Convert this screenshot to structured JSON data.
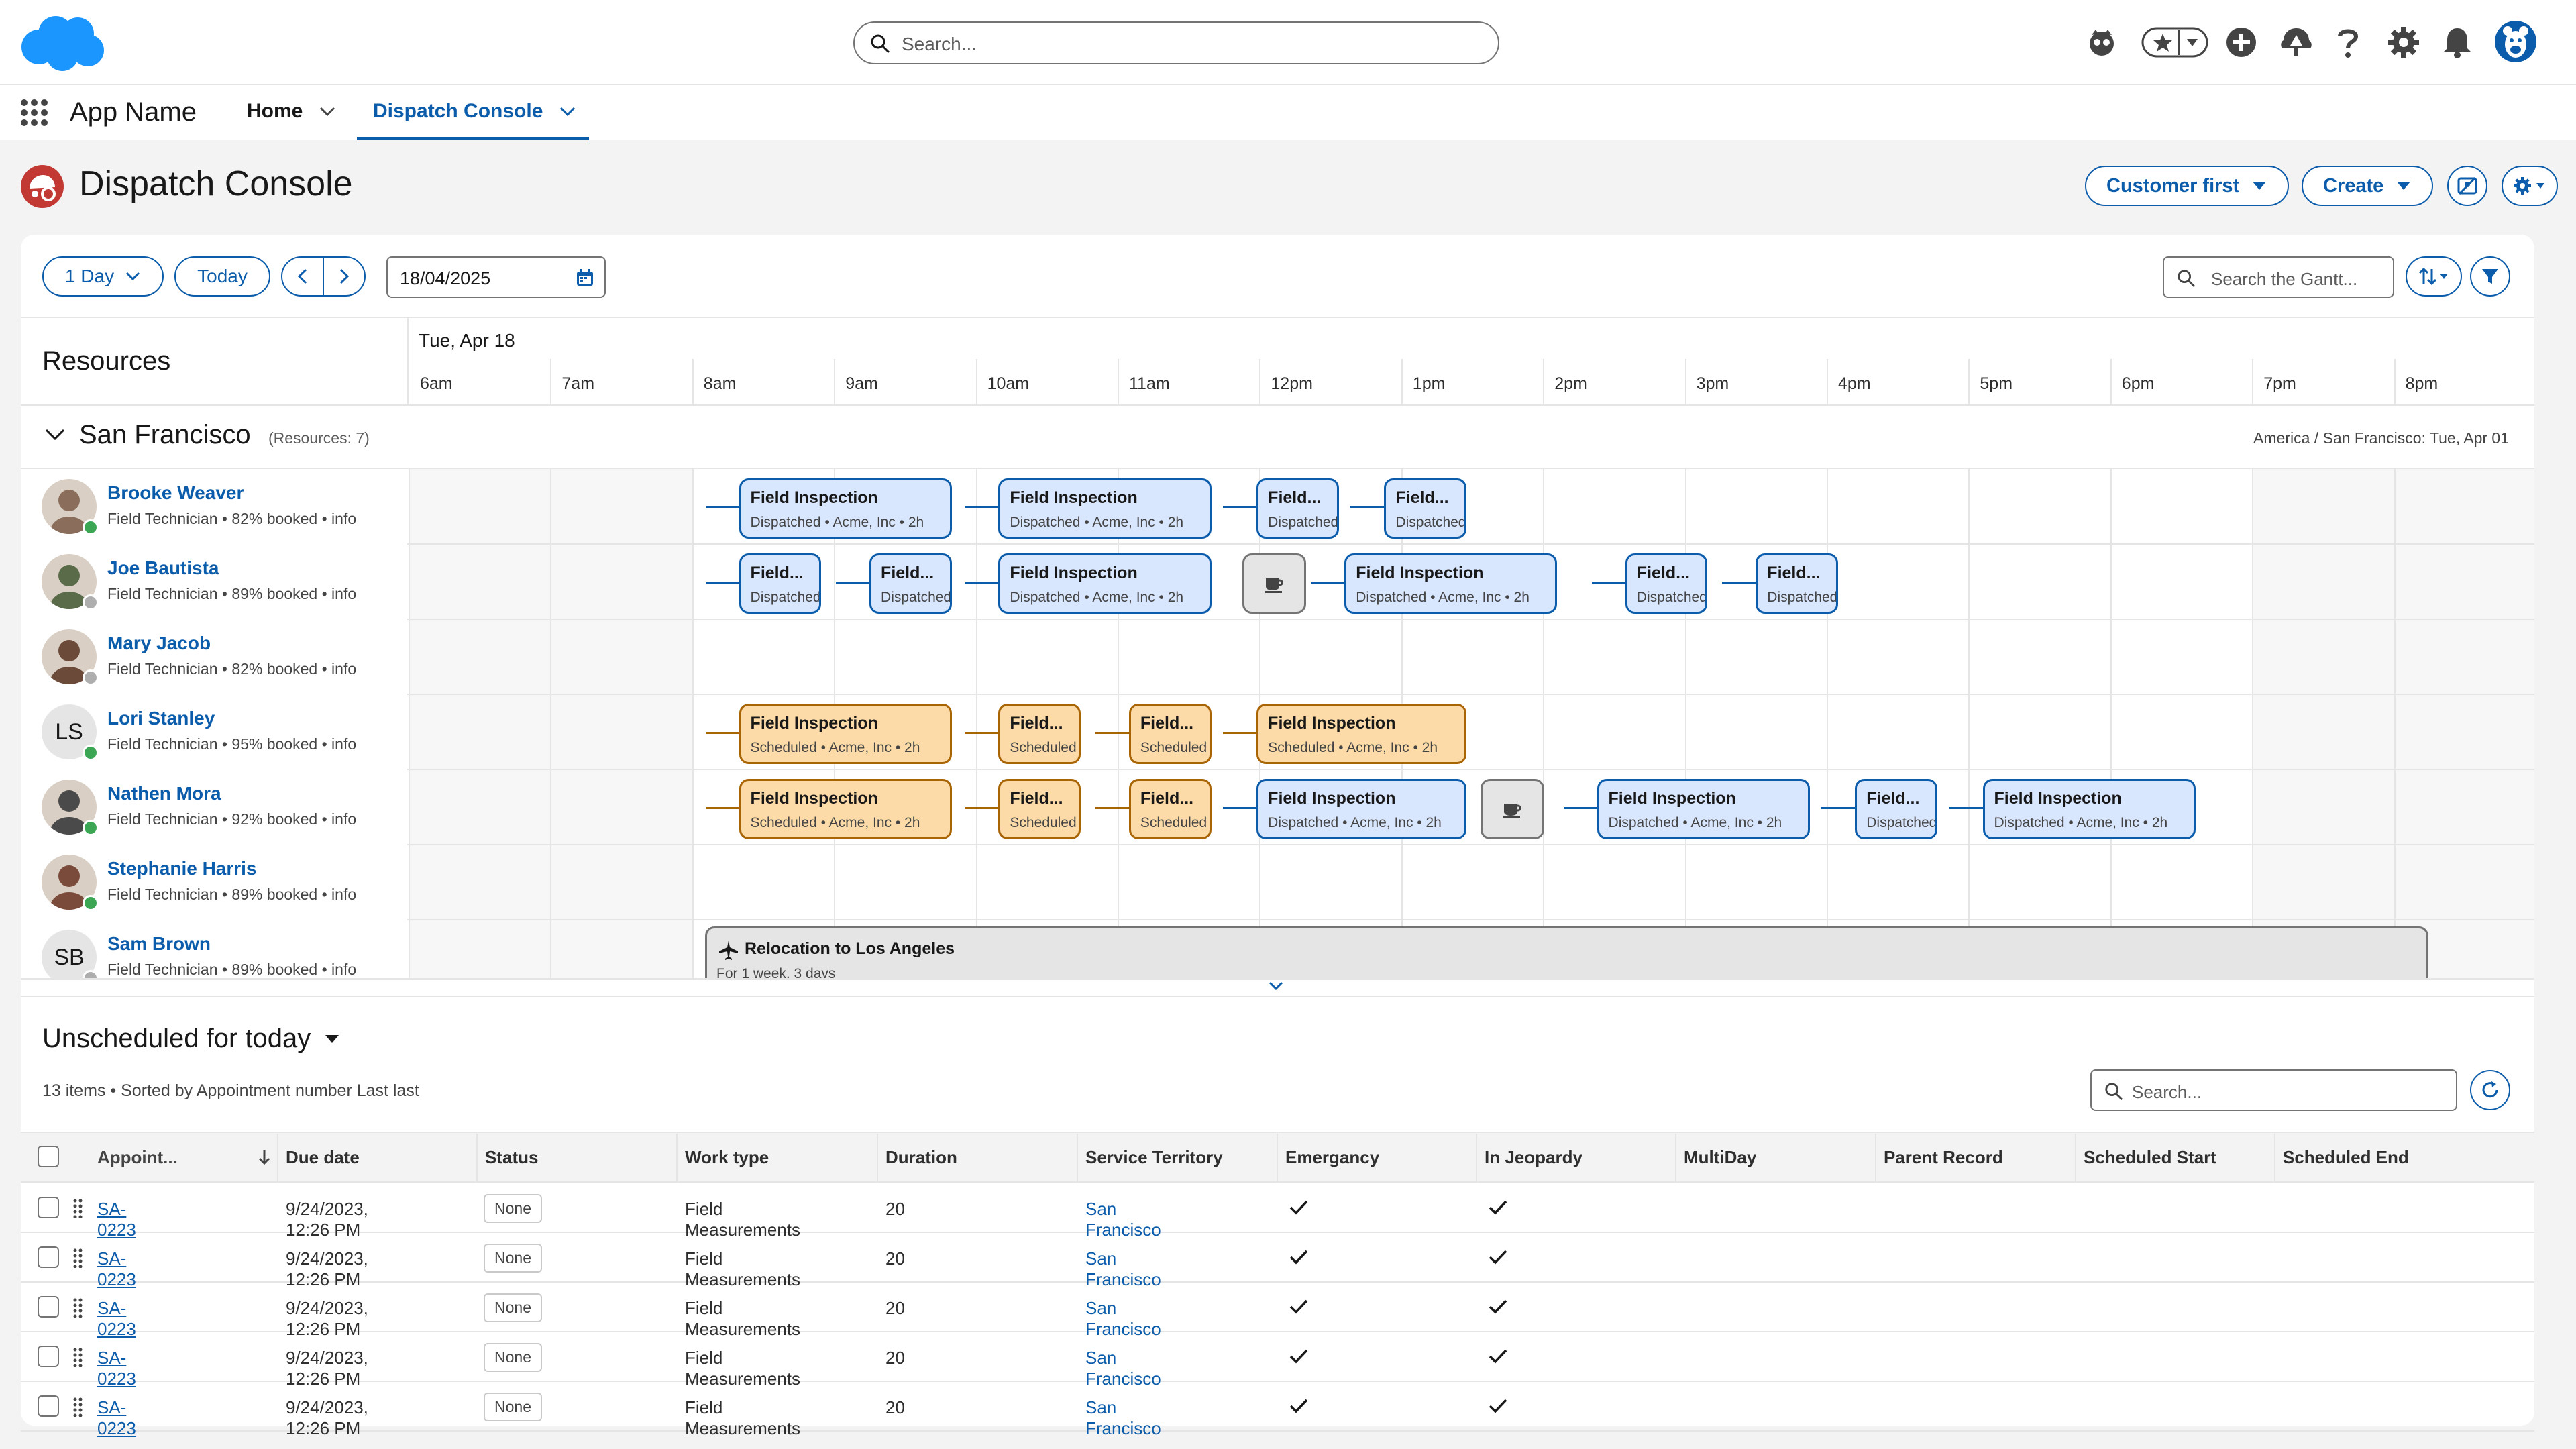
{
  "global_search": {
    "placeholder": "Search..."
  },
  "app": {
    "name": "App Name"
  },
  "nav": {
    "tabs": [
      {
        "label": "Home"
      },
      {
        "label": "Dispatch Console"
      }
    ]
  },
  "page": {
    "title": "Dispatch Console",
    "buttons": {
      "customer_first": "Customer first",
      "create": "Create"
    }
  },
  "toolbar": {
    "view": "1 Day",
    "today": "Today",
    "date": "18/04/2025",
    "gantt_search_placeholder": "Search the Gantt..."
  },
  "gantt": {
    "resources_header": "Resources",
    "date_label": "Tue, Apr 18",
    "hours": [
      "6am",
      "7am",
      "8am",
      "9am",
      "10am",
      "11am",
      "12pm",
      "1pm",
      "2pm",
      "3pm",
      "4pm",
      "5pm",
      "6pm",
      "7pm",
      "8pm"
    ],
    "group": {
      "name": "San Francisco",
      "count": "(Resources: 7)",
      "timezone": "America / San Francisco: Tue, Apr 01"
    },
    "resources": [
      {
        "name": "Brooke Weaver",
        "sub": "Field Technician • 82% booked • info",
        "status_color": "#3ba755"
      },
      {
        "name": "Joe Bautista",
        "sub": "Field Technician • 89% booked • info",
        "status_color": "#aeaeae"
      },
      {
        "name": "Mary Jacob",
        "sub": "Field Technician • 82% booked • info",
        "status_color": "#aeaeae"
      },
      {
        "name": "Lori Stanley",
        "sub": "Field Technician • 95% booked • info",
        "status_color": "#3ba755",
        "initials": "LS"
      },
      {
        "name": "Nathen Mora",
        "sub": "Field Technician • 92% booked • info",
        "status_color": "#3ba755"
      },
      {
        "name": "Stephanie Harris",
        "sub": "Field Technician • 89% booked • info",
        "status_color": "#3ba755"
      },
      {
        "name": "Sam Brown",
        "sub": "Field Technician • 89% booked • info",
        "status_color": "#aeaeae",
        "initials": "SB"
      }
    ],
    "appointments": [
      {
        "row": 0,
        "start": 8.33,
        "end": 9.83,
        "title": "Field Inspection",
        "sub": "Dispatched • Acme, Inc • 2h",
        "color": "blue"
      },
      {
        "row": 0,
        "start": 10.16,
        "end": 11.66,
        "title": "Field Inspection",
        "sub": "Dispatched • Acme, Inc • 2h",
        "color": "blue"
      },
      {
        "row": 0,
        "start": 11.98,
        "end": 12.56,
        "title": "Field...",
        "sub": "Dispatched",
        "color": "blue"
      },
      {
        "row": 0,
        "start": 12.88,
        "end": 13.46,
        "title": "Field...",
        "sub": "Dispatched",
        "color": "blue"
      },
      {
        "row": 1,
        "start": 8.33,
        "end": 8.91,
        "title": "Field...",
        "sub": "Dispatched",
        "color": "blue"
      },
      {
        "row": 1,
        "start": 9.25,
        "end": 9.83,
        "title": "Field...",
        "sub": "Dispatched",
        "color": "blue"
      },
      {
        "row": 1,
        "start": 10.16,
        "end": 11.66,
        "title": "Field Inspection",
        "sub": "Dispatched • Acme, Inc • 2h",
        "color": "blue"
      },
      {
        "row": 1,
        "start": 11.88,
        "end": 12.33,
        "title": "",
        "sub": "",
        "color": "break"
      },
      {
        "row": 1,
        "start": 12.6,
        "end": 14.1,
        "title": "Field Inspection",
        "sub": "Dispatched • Acme, Inc • 2h",
        "color": "blue"
      },
      {
        "row": 1,
        "start": 14.58,
        "end": 15.16,
        "title": "Field...",
        "sub": "Dispatched",
        "color": "blue"
      },
      {
        "row": 1,
        "start": 15.5,
        "end": 16.08,
        "title": "Field...",
        "sub": "Dispatched",
        "color": "blue"
      },
      {
        "row": 3,
        "start": 8.33,
        "end": 9.83,
        "title": "Field Inspection",
        "sub": "Scheduled • Acme, Inc • 2h",
        "color": "orange"
      },
      {
        "row": 3,
        "start": 10.16,
        "end": 10.74,
        "title": "Field...",
        "sub": "Scheduled",
        "color": "orange"
      },
      {
        "row": 3,
        "start": 11.08,
        "end": 11.66,
        "title": "Field...",
        "sub": "Scheduled",
        "color": "orange"
      },
      {
        "row": 3,
        "start": 11.98,
        "end": 13.46,
        "title": "Field Inspection",
        "sub": "Scheduled • Acme, Inc • 2h",
        "color": "orange"
      },
      {
        "row": 4,
        "start": 8.33,
        "end": 9.83,
        "title": "Field Inspection",
        "sub": "Scheduled • Acme, Inc • 2h",
        "color": "orange"
      },
      {
        "row": 4,
        "start": 10.16,
        "end": 10.74,
        "title": "Field...",
        "sub": "Scheduled",
        "color": "orange"
      },
      {
        "row": 4,
        "start": 11.08,
        "end": 11.66,
        "title": "Field...",
        "sub": "Scheduled",
        "color": "orange"
      },
      {
        "row": 4,
        "start": 11.98,
        "end": 13.46,
        "title": "Field Inspection",
        "sub": "Dispatched • Acme, Inc • 2h",
        "color": "blue"
      },
      {
        "row": 4,
        "start": 13.56,
        "end": 14.01,
        "title": "",
        "sub": "",
        "color": "break"
      },
      {
        "row": 4,
        "start": 14.38,
        "end": 15.88,
        "title": "Field Inspection",
        "sub": "Dispatched • Acme, Inc • 2h",
        "color": "blue"
      },
      {
        "row": 4,
        "start": 16.2,
        "end": 16.78,
        "title": "Field...",
        "sub": "Dispatched",
        "color": "blue"
      },
      {
        "row": 4,
        "start": 17.1,
        "end": 18.6,
        "title": "Field Inspection",
        "sub": "Dispatched • Acme, Inc • 2h",
        "color": "blue"
      }
    ],
    "relocation": {
      "title": "Relocation to Los Angeles",
      "sub": "For 1 week, 3 days"
    }
  },
  "unscheduled": {
    "title": "Unscheduled for today",
    "meta": "13 items • Sorted by Appointment number Last last",
    "search_placeholder": "Search...",
    "columns": [
      "Appoint...",
      "Due date",
      "Status",
      "Work type",
      "Duration",
      "Service Territory",
      "Emergancy",
      "In Jeopardy",
      "MultiDay",
      "Parent Record",
      "Scheduled Start",
      "Scheduled End"
    ],
    "rows": [
      {
        "id": "SA-0223",
        "due": "9/24/2023, 12:26 PM",
        "status": "None",
        "work_type": "Field Measurements",
        "duration": "20",
        "territory": "San Francisco"
      },
      {
        "id": "SA-0223",
        "due": "9/24/2023, 12:26 PM",
        "status": "None",
        "work_type": "Field Measurements",
        "duration": "20",
        "territory": "San Francisco"
      },
      {
        "id": "SA-0223",
        "due": "9/24/2023, 12:26 PM",
        "status": "None",
        "work_type": "Field Measurements",
        "duration": "20",
        "territory": "San Francisco"
      },
      {
        "id": "SA-0223",
        "due": "9/24/2023, 12:26 PM",
        "status": "None",
        "work_type": "Field Measurements",
        "duration": "20",
        "territory": "San Francisco"
      },
      {
        "id": "SA-0223",
        "due": "9/24/2023, 12:26 PM",
        "status": "None",
        "work_type": "Field Measurements",
        "duration": "20",
        "territory": "San Francisco"
      }
    ]
  },
  "colors": {
    "brand": "#0b5cab",
    "cloud": "#1b96ff",
    "scheduled": "#fcdba8",
    "dispatched": "#d8e6fe",
    "console_icon": "#c23934"
  }
}
